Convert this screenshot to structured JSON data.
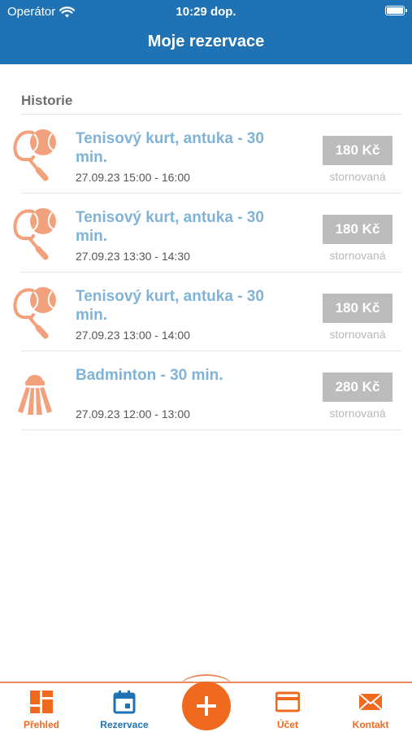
{
  "status_bar": {
    "carrier": "Operátor",
    "time": "10:29 dop."
  },
  "header": {
    "title": "Moje rezervace"
  },
  "section": {
    "title": "Historie"
  },
  "reservations": [
    {
      "sport": "tennis",
      "icon": "tennis-icon",
      "title": "Tenisový kurt, antuka - 30 min.",
      "time": "27.09.23 15:00 - 16:00",
      "price": "180 Kč",
      "status": "stornovaná"
    },
    {
      "sport": "tennis",
      "icon": "tennis-icon",
      "title": "Tenisový kurt, antuka - 30 min.",
      "time": "27.09.23 13:30 - 14:30",
      "price": "180 Kč",
      "status": "stornovaná"
    },
    {
      "sport": "tennis",
      "icon": "tennis-icon",
      "title": "Tenisový kurt, antuka - 30 min.",
      "time": "27.09.23 13:00 - 14:00",
      "price": "180 Kč",
      "status": "stornovaná"
    },
    {
      "sport": "badminton",
      "icon": "shuttlecock-icon",
      "title": "Badminton - 30 min.",
      "time": "27.09.23 12:00 - 13:00",
      "price": "280 Kč",
      "status": "stornovaná"
    }
  ],
  "tabs": [
    {
      "label": "Přehled",
      "icon": "dashboard-icon",
      "color": "#ef6a1f"
    },
    {
      "label": "Rezervace",
      "icon": "calendar-icon",
      "color": "#1f73b5"
    },
    {
      "label": "Účet",
      "icon": "card-icon",
      "color": "#ef6a1f"
    },
    {
      "label": "Kontakt",
      "icon": "mail-icon",
      "color": "#ef6a1f"
    }
  ],
  "fab": {
    "icon": "plus-icon"
  },
  "colors": {
    "header": "#1f73b5",
    "accent": "#ef6a1f",
    "icon_light": "#f3a17c",
    "title_blue": "#7fb3d7",
    "badge_gray": "#bcbcbc"
  }
}
